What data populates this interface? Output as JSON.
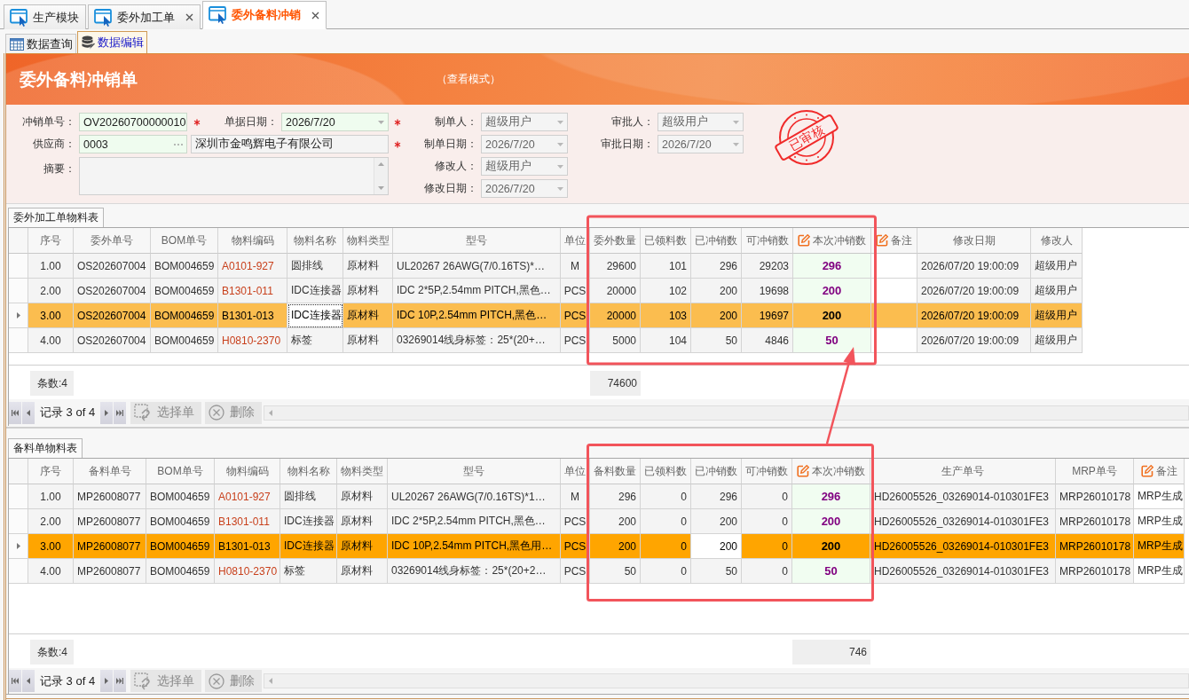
{
  "top_tabs": [
    {
      "label": "生产模块",
      "selected": false,
      "closable": false
    },
    {
      "label": "委外加工单",
      "selected": false,
      "closable": true
    },
    {
      "label": "委外备料冲销",
      "selected": true,
      "closable": true
    }
  ],
  "sub_tabs": [
    {
      "label": "数据查询",
      "selected": false
    },
    {
      "label": "数据编辑",
      "selected": true
    }
  ],
  "banner": {
    "title": "委外备料冲销单",
    "mode": "（查看模式）"
  },
  "form": {
    "voucher_no": {
      "label": "冲销单号：",
      "value": "OV20260700000010",
      "required": true
    },
    "doc_date": {
      "label": "单据日期：",
      "value": "2026/7/20",
      "required": true
    },
    "supplier": {
      "label": "供应商：",
      "code": "0003",
      "name": "深圳市金鸣辉电子有限公司",
      "required": true
    },
    "memo": {
      "label": "摘要："
    },
    "audit_fields": [
      {
        "label": "制单人：",
        "value": "超级用户",
        "disabled": true
      },
      {
        "label": "制单日期：",
        "value": "2026/7/20",
        "disabled": true
      },
      {
        "label": "修改人：",
        "value": "超级用户",
        "disabled": true
      },
      {
        "label": "修改日期：",
        "value": "2026/7/20",
        "disabled": true
      }
    ],
    "approval_fields": [
      {
        "label": "审批人：",
        "value": "超级用户",
        "disabled": true
      },
      {
        "label": "审批日期：",
        "value": "2026/7/20",
        "disabled": true
      }
    ],
    "stamp": "已审核"
  },
  "grids": [
    {
      "title": "委外加工单物料表",
      "active": false,
      "columns": [
        {
          "label": "序号",
          "kind": "seq",
          "editable": false,
          "focused": false,
          "summary": "条数:4"
        },
        {
          "label": "委外单号",
          "kind": "text",
          "editable": false,
          "focused": false
        },
        {
          "label": "BOM单号",
          "kind": "text",
          "editable": false,
          "focused": false
        },
        {
          "label": "物料编码",
          "kind": "code",
          "editable": false,
          "focused": false
        },
        {
          "label": "物料名称",
          "kind": "text",
          "editable": false,
          "focused": true
        },
        {
          "label": "物料类型",
          "kind": "text",
          "editable": false,
          "focused": false
        },
        {
          "label": "型号",
          "kind": "text",
          "editable": false,
          "focused": false
        },
        {
          "label": "单位",
          "kind": "unit",
          "editable": false,
          "focused": false
        },
        {
          "label": "委外数量",
          "kind": "number",
          "editable": false,
          "focused": false,
          "summary": "74600"
        },
        {
          "label": "已领料数",
          "kind": "number",
          "editable": false,
          "focused": false
        },
        {
          "label": "已冲销数",
          "kind": "number",
          "editable": false,
          "focused": false
        },
        {
          "label": "可冲销数",
          "kind": "number",
          "editable": false,
          "focused": false
        },
        {
          "label": "本次冲销数",
          "kind": "amount",
          "editable": true,
          "focused": false
        },
        {
          "label": "备注",
          "kind": "text",
          "editable": true,
          "focused": false
        },
        {
          "label": "修改日期",
          "kind": "text",
          "editable": false,
          "focused": false
        },
        {
          "label": "修改人",
          "kind": "text",
          "editable": false,
          "focused": false
        }
      ],
      "rows": [
        {
          "selected": false,
          "cells": [
            "1.00",
            "OS202607004",
            "BOM004659",
            "A0101-927",
            "圆排线",
            "原材料",
            "UL20267 26AWG(7/0.16TS)*…",
            "M",
            "29600",
            "101",
            "296",
            "29203",
            "296",
            null,
            "2026/07/20 19:00:09",
            "超级用户"
          ]
        },
        {
          "selected": false,
          "cells": [
            "2.00",
            "OS202607004",
            "BOM004659",
            "B1301-011",
            "IDC连接器",
            "原材料",
            "IDC 2*5P,2.54mm PITCH,黑色…",
            "PCS",
            "20000",
            "102",
            "200",
            "19698",
            "200",
            null,
            "2026/07/20 19:00:09",
            "超级用户"
          ]
        },
        {
          "selected": true,
          "cells": [
            "3.00",
            "OS202607004",
            "BOM004659",
            "B1301-013",
            "IDC连接器",
            "原材料",
            "IDC 10P,2.54mm PITCH,黑色…",
            "PCS",
            "20000",
            "103",
            "200",
            "19697",
            "200",
            null,
            "2026/07/20 19:00:09",
            "超级用户"
          ]
        },
        {
          "selected": false,
          "cells": [
            "4.00",
            "OS202607004",
            "BOM004659",
            "H0810-2370",
            "标签",
            "原材料",
            "03269014线身标签：25*(20+…",
            "PCS",
            "5000",
            "104",
            "50",
            "4846",
            "50",
            null,
            "2026/07/20 19:00:09",
            "超级用户"
          ]
        }
      ],
      "navigator": {
        "record": "记录 3 of 4",
        "buttons": [
          {
            "label": "选择单",
            "disabled": true
          },
          {
            "label": "删除",
            "disabled": true
          }
        ]
      }
    },
    {
      "title": "备料单物料表",
      "active": true,
      "columns": [
        {
          "label": "序号",
          "kind": "seq",
          "editable": false,
          "focused": false,
          "summary": "条数:4"
        },
        {
          "label": "备料单号",
          "kind": "text",
          "editable": false,
          "focused": false
        },
        {
          "label": "BOM单号",
          "kind": "text",
          "editable": false,
          "focused": false
        },
        {
          "label": "物料编码",
          "kind": "code",
          "editable": false,
          "focused": false
        },
        {
          "label": "物料名称",
          "kind": "text",
          "editable": false,
          "focused": false
        },
        {
          "label": "物料类型",
          "kind": "text",
          "editable": false,
          "focused": false
        },
        {
          "label": "型号",
          "kind": "text",
          "editable": false,
          "focused": false
        },
        {
          "label": "单位",
          "kind": "unit",
          "editable": false,
          "focused": false
        },
        {
          "label": "备料数量",
          "kind": "number",
          "editable": false,
          "focused": false
        },
        {
          "label": "已领料数",
          "kind": "number",
          "editable": false,
          "focused": false
        },
        {
          "label": "已冲销数",
          "kind": "number",
          "editable": false,
          "focused": true
        },
        {
          "label": "可冲销数",
          "kind": "number",
          "editable": false,
          "focused": false
        },
        {
          "label": "本次冲销数",
          "kind": "amount",
          "editable": true,
          "focused": false,
          "summary": "746"
        },
        {
          "label": "生产单号",
          "kind": "text",
          "editable": false,
          "focused": false
        },
        {
          "label": "MRP单号",
          "kind": "text",
          "editable": false,
          "focused": false
        },
        {
          "label": "备注",
          "kind": "text",
          "editable": true,
          "focused": false
        }
      ],
      "rows": [
        {
          "selected": false,
          "cells": [
            "1.00",
            "MP26008077",
            "BOM004659",
            "A0101-927",
            "圆排线",
            "原材料",
            "UL20267 26AWG(7/0.16TS)*1…",
            "M",
            "296",
            "0",
            "296",
            "0",
            "296",
            "HD26005526_03269014-010301FE3",
            "MRP26010178",
            "MRP生成"
          ]
        },
        {
          "selected": false,
          "cells": [
            "2.00",
            "MP26008077",
            "BOM004659",
            "B1301-011",
            "IDC连接器",
            "原材料",
            "IDC 2*5P,2.54mm PITCH,黑色…",
            "PCS",
            "200",
            "0",
            "200",
            "0",
            "200",
            "HD26005526_03269014-010301FE3",
            "MRP26010178",
            "MRP生成"
          ]
        },
        {
          "selected": true,
          "cells": [
            "3.00",
            "MP26008077",
            "BOM004659",
            "B1301-013",
            "IDC连接器",
            "原材料",
            "IDC 10P,2.54mm PITCH,黑色用…",
            "PCS",
            "200",
            "0",
            "200",
            "0",
            "200",
            "HD26005526_03269014-010301FE3",
            "MRP26010178",
            "MRP生成"
          ]
        },
        {
          "selected": false,
          "cells": [
            "4.00",
            "MP26008077",
            "BOM004659",
            "H0810-2370",
            "标签",
            "原材料",
            "03269014线身标签：25*(20+2…",
            "PCS",
            "50",
            "0",
            "50",
            "0",
            "50",
            "HD26005526_03269014-010301FE3",
            "MRP26010178",
            "MRP生成"
          ]
        }
      ],
      "navigator": {
        "record": "记录 3 of 4",
        "buttons": [
          {
            "label": "选择单",
            "disabled": true
          },
          {
            "label": "删除",
            "disabled": true
          }
        ]
      }
    }
  ]
}
